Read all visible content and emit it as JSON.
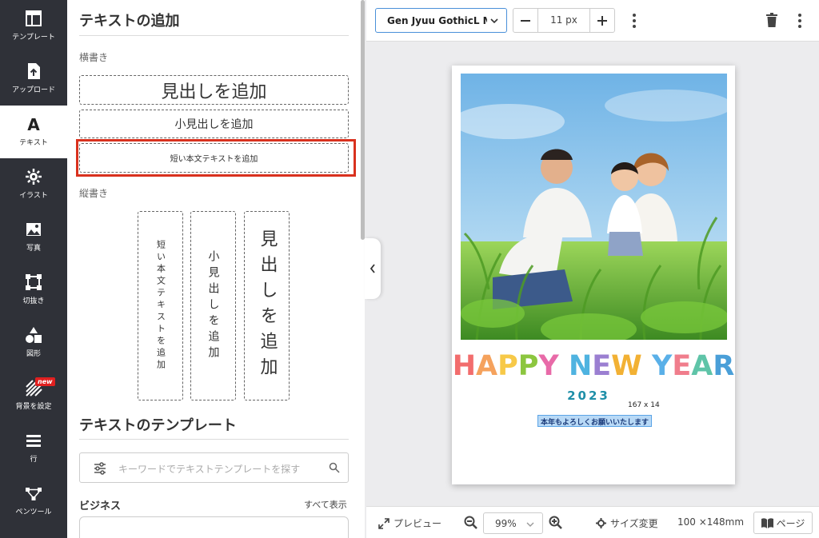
{
  "rail": {
    "items": [
      {
        "label": "テンプレート",
        "icon": "template-icon"
      },
      {
        "label": "アップロード",
        "icon": "upload-icon"
      },
      {
        "label": "テキスト",
        "icon": "text-icon",
        "active": true
      },
      {
        "label": "イラスト",
        "icon": "illustration-icon"
      },
      {
        "label": "写真",
        "icon": "photo-icon"
      },
      {
        "label": "切抜き",
        "icon": "crop-icon"
      },
      {
        "label": "図形",
        "icon": "shapes-icon"
      },
      {
        "label": "背景を設定",
        "icon": "background-icon",
        "badge": "new"
      },
      {
        "label": "行",
        "icon": "rows-icon"
      },
      {
        "label": "ペンツール",
        "icon": "pen-tool-icon"
      }
    ]
  },
  "panel": {
    "title": "テキストの追加",
    "horizontal_label": "横書き",
    "horizontal": {
      "heading": "見出しを追加",
      "subheading": "小見出しを追加",
      "body": "短い本文テキストを追加"
    },
    "vertical_label": "縦書き",
    "vertical": {
      "body": "短い本文テキストを追加",
      "subheading": "小見出しを追加",
      "heading": "見出しを追加"
    },
    "templates_title": "テキストのテンプレート",
    "search_placeholder": "キーワードでテキストテンプレートを探す",
    "category": "ビジネス",
    "show_all": "すべて表示"
  },
  "toolbar": {
    "font": "Gen Jyuu GothicL Medium",
    "font_size": "11 px"
  },
  "canvas": {
    "hny_letters": [
      {
        "ch": "H",
        "color": "#f26d6d"
      },
      {
        "ch": "A",
        "color": "#f5a25d"
      },
      {
        "ch": "P",
        "color": "#f7c948"
      },
      {
        "ch": "P",
        "color": "#8cc63f"
      },
      {
        "ch": "Y",
        "color": "#e86aa8"
      },
      {
        "ch": " ",
        "color": "#ffffff"
      },
      {
        "ch": "N",
        "color": "#4fb3e0"
      },
      {
        "ch": "E",
        "color": "#9b7fd1"
      },
      {
        "ch": "W",
        "color": "#f2b134"
      },
      {
        "ch": " ",
        "color": "#ffffff"
      },
      {
        "ch": "Y",
        "color": "#5ab0e8"
      },
      {
        "ch": "E",
        "color": "#f07d8c"
      },
      {
        "ch": "A",
        "color": "#5fc4a8"
      },
      {
        "ch": "R",
        "color": "#4a9fd8"
      }
    ],
    "year": "2023",
    "selection_size": "167 x 14",
    "greeting": "本年もよろしくお願いいたします"
  },
  "bottombar": {
    "preview": "プレビュー",
    "zoom": "99%",
    "resize": "サイズ変更",
    "paper_size": "100 ×148mm",
    "page": "ページ"
  }
}
